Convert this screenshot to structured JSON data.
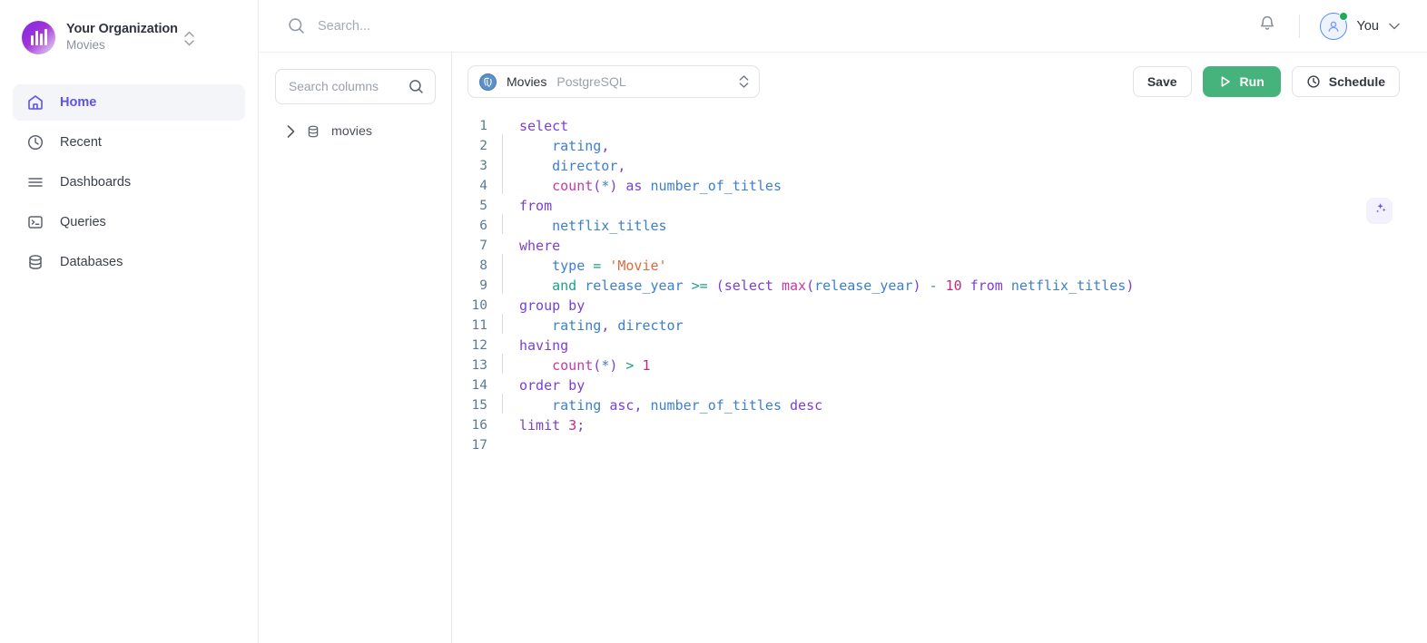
{
  "sidebar": {
    "org": {
      "name": "Your Organization",
      "project": "Movies",
      "logo_icon": "org-bars-logo",
      "switcher_icon": "chevron-up-down-icon"
    },
    "items": [
      {
        "label": "Home",
        "icon": "home-icon",
        "active": true
      },
      {
        "label": "Recent",
        "icon": "clock-icon",
        "active": false
      },
      {
        "label": "Dashboards",
        "icon": "layers-icon",
        "active": false
      },
      {
        "label": "Queries",
        "icon": "terminal-icon",
        "active": false
      },
      {
        "label": "Databases",
        "icon": "database-icon",
        "active": false
      }
    ]
  },
  "topbar": {
    "search": {
      "placeholder": "Search...",
      "value": "",
      "icon": "search-icon"
    },
    "bell_icon": "bell-icon",
    "user": {
      "name": "You",
      "status": "online",
      "avatar_icon": "user-avatar-icon",
      "caret_icon": "chevron-down-icon"
    }
  },
  "columns_pane": {
    "search": {
      "placeholder": "Search columns",
      "value": "",
      "icon": "search-icon"
    },
    "tree": [
      {
        "label": "movies",
        "icon": "database-icon",
        "expand_icon": "chevron-right-icon",
        "expanded": false
      }
    ]
  },
  "editor": {
    "connection": {
      "name": "Movies",
      "engine": "PostgreSQL",
      "icon": "postgresql-icon",
      "chevron_icon": "chevron-up-down-icon"
    },
    "actions": {
      "save_label": "Save",
      "run_label": "Run",
      "run_icon": "play-icon",
      "schedule_label": "Schedule",
      "schedule_icon": "clock-icon"
    },
    "ai_icon": "sparkles-icon",
    "accent_green": "#45b37b",
    "accent_purple": "#5b52f0",
    "lines": [
      {
        "n": 1,
        "indent": 0,
        "tokens": [
          {
            "t": "select",
            "c": "kw"
          }
        ]
      },
      {
        "n": 2,
        "indent": 1,
        "tokens": [
          {
            "t": "rating",
            "c": "id"
          },
          {
            "t": ",",
            "c": "punc"
          }
        ]
      },
      {
        "n": 3,
        "indent": 1,
        "tokens": [
          {
            "t": "director",
            "c": "id"
          },
          {
            "t": ",",
            "c": "punc"
          }
        ]
      },
      {
        "n": 4,
        "indent": 1,
        "tokens": [
          {
            "t": "count",
            "c": "fn"
          },
          {
            "t": "(",
            "c": "punc"
          },
          {
            "t": "*",
            "c": "id"
          },
          {
            "t": ")",
            "c": "punc"
          },
          {
            "t": " ",
            "c": "plain"
          },
          {
            "t": "as",
            "c": "kw"
          },
          {
            "t": " ",
            "c": "plain"
          },
          {
            "t": "number_of_titles",
            "c": "id"
          }
        ]
      },
      {
        "n": 5,
        "indent": 0,
        "tokens": [
          {
            "t": "from",
            "c": "kw"
          }
        ]
      },
      {
        "n": 6,
        "indent": 1,
        "tokens": [
          {
            "t": "netflix_titles",
            "c": "id"
          }
        ]
      },
      {
        "n": 7,
        "indent": 0,
        "tokens": [
          {
            "t": "where",
            "c": "kw"
          }
        ]
      },
      {
        "n": 8,
        "indent": 1,
        "tokens": [
          {
            "t": "type",
            "c": "id"
          },
          {
            "t": " ",
            "c": "plain"
          },
          {
            "t": "=",
            "c": "op"
          },
          {
            "t": " ",
            "c": "plain"
          },
          {
            "t": "'Movie'",
            "c": "str"
          }
        ]
      },
      {
        "n": 9,
        "indent": 1,
        "tokens": [
          {
            "t": "and",
            "c": "op"
          },
          {
            "t": " ",
            "c": "plain"
          },
          {
            "t": "release_year",
            "c": "id"
          },
          {
            "t": " ",
            "c": "plain"
          },
          {
            "t": ">=",
            "c": "op"
          },
          {
            "t": " ",
            "c": "plain"
          },
          {
            "t": "(",
            "c": "punc"
          },
          {
            "t": "select",
            "c": "kw"
          },
          {
            "t": " ",
            "c": "plain"
          },
          {
            "t": "max",
            "c": "fn"
          },
          {
            "t": "(",
            "c": "punc"
          },
          {
            "t": "release_year",
            "c": "id"
          },
          {
            "t": ")",
            "c": "punc"
          },
          {
            "t": " ",
            "c": "plain"
          },
          {
            "t": "-",
            "c": "op"
          },
          {
            "t": " ",
            "c": "plain"
          },
          {
            "t": "10",
            "c": "num"
          },
          {
            "t": " ",
            "c": "plain"
          },
          {
            "t": "from",
            "c": "kw"
          },
          {
            "t": " ",
            "c": "plain"
          },
          {
            "t": "netflix_titles",
            "c": "id"
          },
          {
            "t": ")",
            "c": "punc"
          }
        ]
      },
      {
        "n": 10,
        "indent": 0,
        "tokens": [
          {
            "t": "group by",
            "c": "kw"
          }
        ]
      },
      {
        "n": 11,
        "indent": 1,
        "tokens": [
          {
            "t": "rating",
            "c": "id"
          },
          {
            "t": ",",
            "c": "punc"
          },
          {
            "t": " ",
            "c": "plain"
          },
          {
            "t": "director",
            "c": "id"
          }
        ]
      },
      {
        "n": 12,
        "indent": 0,
        "tokens": [
          {
            "t": "having",
            "c": "kw"
          }
        ]
      },
      {
        "n": 13,
        "indent": 1,
        "tokens": [
          {
            "t": "count",
            "c": "fn"
          },
          {
            "t": "(",
            "c": "punc"
          },
          {
            "t": "*",
            "c": "id"
          },
          {
            "t": ")",
            "c": "punc"
          },
          {
            "t": " ",
            "c": "plain"
          },
          {
            "t": ">",
            "c": "op"
          },
          {
            "t": " ",
            "c": "plain"
          },
          {
            "t": "1",
            "c": "num"
          }
        ]
      },
      {
        "n": 14,
        "indent": 0,
        "tokens": [
          {
            "t": "order by",
            "c": "kw"
          }
        ]
      },
      {
        "n": 15,
        "indent": 1,
        "tokens": [
          {
            "t": "rating",
            "c": "id"
          },
          {
            "t": " ",
            "c": "plain"
          },
          {
            "t": "asc",
            "c": "kw"
          },
          {
            "t": ",",
            "c": "punc"
          },
          {
            "t": " ",
            "c": "plain"
          },
          {
            "t": "number_of_titles",
            "c": "id"
          },
          {
            "t": " ",
            "c": "plain"
          },
          {
            "t": "desc",
            "c": "kw"
          }
        ]
      },
      {
        "n": 16,
        "indent": 0,
        "tokens": [
          {
            "t": "limit",
            "c": "kw"
          },
          {
            "t": " ",
            "c": "plain"
          },
          {
            "t": "3",
            "c": "num"
          },
          {
            "t": ";",
            "c": "punc"
          }
        ]
      },
      {
        "n": 17,
        "indent": 0,
        "tokens": []
      }
    ]
  }
}
